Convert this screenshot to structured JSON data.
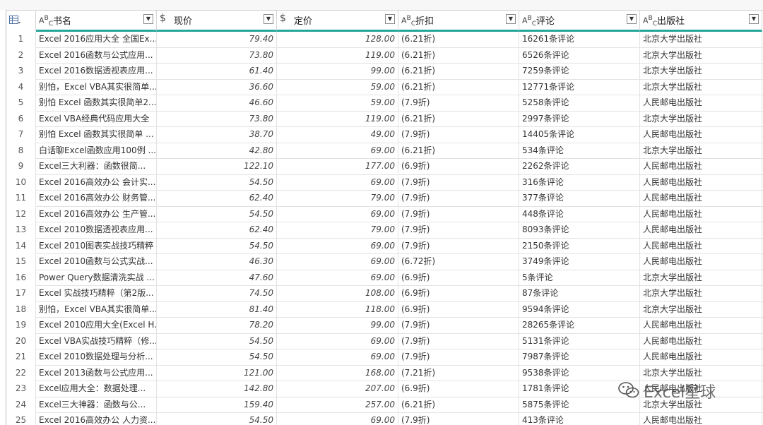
{
  "columns": [
    {
      "key": "name",
      "type": "text",
      "type_label": "A",
      "type_sub": "C",
      "label": "书名"
    },
    {
      "key": "price",
      "type": "currency",
      "type_label": "$",
      "label": "现价"
    },
    {
      "key": "list_price",
      "type": "currency",
      "type_label": "$",
      "label": "定价"
    },
    {
      "key": "discount",
      "type": "text",
      "type_label": "A",
      "type_sub": "C",
      "label": "折扣"
    },
    {
      "key": "reviews",
      "type": "text",
      "type_label": "A",
      "type_sub": "C",
      "label": "评论"
    },
    {
      "key": "publisher",
      "type": "text",
      "type_label": "A",
      "type_sub": "C",
      "label": "出版社"
    }
  ],
  "dropdown_glyph": "▼",
  "rows": [
    {
      "n": "1",
      "name": "Excel 2016应用大全 全国Ex...",
      "price": "79.40",
      "list_price": "128.00",
      "discount": "(6.21折)",
      "reviews": "16261条评论",
      "publisher": "北京大学出版社"
    },
    {
      "n": "2",
      "name": "Excel 2016函数与公式应用...",
      "price": "73.80",
      "list_price": "119.00",
      "discount": "(6.21折)",
      "reviews": "6526条评论",
      "publisher": "北京大学出版社"
    },
    {
      "n": "3",
      "name": "Excel 2016数据透视表应用...",
      "price": "61.40",
      "list_price": "99.00",
      "discount": "(6.21折)",
      "reviews": "7259条评论",
      "publisher": "北京大学出版社"
    },
    {
      "n": "4",
      "name": "别怕，Excel VBA其实很简单...",
      "price": "36.60",
      "list_price": "59.00",
      "discount": "(6.21折)",
      "reviews": "12771条评论",
      "publisher": "北京大学出版社"
    },
    {
      "n": "5",
      "name": "别怕 Excel 函数其实很简单2...",
      "price": "46.60",
      "list_price": "59.00",
      "discount": "(7.9折)",
      "reviews": "5258条评论",
      "publisher": "人民邮电出版社"
    },
    {
      "n": "6",
      "name": "Excel VBA经典代码应用大全",
      "price": "73.80",
      "list_price": "119.00",
      "discount": "(6.21折)",
      "reviews": "2997条评论",
      "publisher": "北京大学出版社"
    },
    {
      "n": "7",
      "name": "别怕 Excel 函数其实很简单 ...",
      "price": "38.70",
      "list_price": "49.00",
      "discount": "(7.9折)",
      "reviews": "14405条评论",
      "publisher": "人民邮电出版社"
    },
    {
      "n": "8",
      "name": "白话聊Excel函数应用100例 ...",
      "price": "42.80",
      "list_price": "69.00",
      "discount": "(6.21折)",
      "reviews": "534条评论",
      "publisher": "北京大学出版社"
    },
    {
      "n": "9",
      "name": "Excel三大利器：函数很简...",
      "price": "122.10",
      "list_price": "177.00",
      "discount": "(6.9折)",
      "reviews": "2262条评论",
      "publisher": "人民邮电出版社"
    },
    {
      "n": "10",
      "name": "Excel 2016高效办公 会计实...",
      "price": "54.50",
      "list_price": "69.00",
      "discount": "(7.9折)",
      "reviews": "316条评论",
      "publisher": "人民邮电出版社"
    },
    {
      "n": "11",
      "name": "Excel 2016高效办公 财务管...",
      "price": "62.40",
      "list_price": "79.00",
      "discount": "(7.9折)",
      "reviews": "377条评论",
      "publisher": "人民邮电出版社"
    },
    {
      "n": "12",
      "name": "Excel 2016高效办公 生产管...",
      "price": "54.50",
      "list_price": "69.00",
      "discount": "(7.9折)",
      "reviews": "448条评论",
      "publisher": "人民邮电出版社"
    },
    {
      "n": "13",
      "name": "Excel 2010数据透视表应用...",
      "price": "62.40",
      "list_price": "79.00",
      "discount": "(7.9折)",
      "reviews": "8093条评论",
      "publisher": "人民邮电出版社"
    },
    {
      "n": "14",
      "name": "Excel 2010图表实战技巧精粹",
      "price": "54.50",
      "list_price": "69.00",
      "discount": "(7.9折)",
      "reviews": "2150条评论",
      "publisher": "人民邮电出版社"
    },
    {
      "n": "15",
      "name": "Excel 2010函数与公式实战...",
      "price": "46.30",
      "list_price": "69.00",
      "discount": "(6.72折)",
      "reviews": "3749条评论",
      "publisher": "人民邮电出版社"
    },
    {
      "n": "16",
      "name": "Power Query数据清洗实战 ...",
      "price": "47.60",
      "list_price": "69.00",
      "discount": "(6.9折)",
      "reviews": "5条评论",
      "publisher": "北京大学出版社"
    },
    {
      "n": "17",
      "name": "Excel 实战技巧精粹（第2版...",
      "price": "74.50",
      "list_price": "108.00",
      "discount": "(6.9折)",
      "reviews": "87条评论",
      "publisher": "北京大学出版社"
    },
    {
      "n": "18",
      "name": "别怕，Excel VBA其实很简单...",
      "price": "81.40",
      "list_price": "118.00",
      "discount": "(6.9折)",
      "reviews": "9594条评论",
      "publisher": "北京大学出版社"
    },
    {
      "n": "19",
      "name": "Excel 2010应用大全(Excel H...",
      "price": "78.20",
      "list_price": "99.00",
      "discount": "(7.9折)",
      "reviews": "28265条评论",
      "publisher": "人民邮电出版社"
    },
    {
      "n": "20",
      "name": "Excel VBA实战技巧精粹（修...",
      "price": "54.50",
      "list_price": "69.00",
      "discount": "(7.9折)",
      "reviews": "5131条评论",
      "publisher": "人民邮电出版社"
    },
    {
      "n": "21",
      "name": "Excel 2010数据处理与分析...",
      "price": "54.50",
      "list_price": "69.00",
      "discount": "(7.9折)",
      "reviews": "7987条评论",
      "publisher": "人民邮电出版社"
    },
    {
      "n": "22",
      "name": "Excel 2013函数与公式应用...",
      "price": "121.00",
      "list_price": "168.00",
      "discount": "(7.21折)",
      "reviews": "9538条评论",
      "publisher": "北京大学出版社"
    },
    {
      "n": "23",
      "name": "Excel应用大全：数据处理...",
      "price": "142.80",
      "list_price": "207.00",
      "discount": "(6.9折)",
      "reviews": "1781条评论",
      "publisher": "人民邮电出版社"
    },
    {
      "n": "24",
      "name": "Excel三大神器：函数与公...",
      "price": "159.40",
      "list_price": "257.00",
      "discount": "(6.21折)",
      "reviews": "5875条评论",
      "publisher": "北京大学出版社"
    },
    {
      "n": "25",
      "name": "Excel 2016高效办公 人力资...",
      "price": "54.50",
      "list_price": "69.00",
      "discount": "(7.9折)",
      "reviews": "413条评论",
      "publisher": "人民邮电出版社"
    }
  ],
  "watermark": {
    "text": "Excel星球"
  }
}
